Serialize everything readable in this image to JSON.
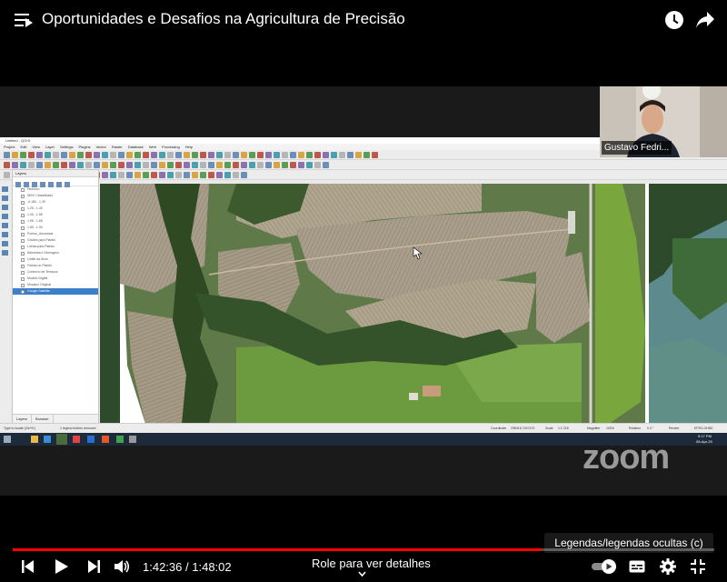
{
  "header": {
    "title": "Oportunidades e Desafios na Agricultura de Precisão",
    "icons": [
      "menu-icon",
      "watch-later-icon",
      "share-icon"
    ]
  },
  "qgis": {
    "title": "Untitled - QGIS",
    "menu": [
      "Project",
      "Edit",
      "View",
      "Layer",
      "Settings",
      "Plugins",
      "Vector",
      "Raster",
      "Database",
      "Web",
      "Processing",
      "Help"
    ],
    "panel_title": "Layers",
    "layers": [
      {
        "label": "Histórico",
        "selected": false
      },
      {
        "label": "NDVI Classificado",
        "selected": false
      },
      {
        "label": "-0.180 - 1.25",
        "selected": false
      },
      {
        "label": "1.25 - 1.40",
        "selected": false
      },
      {
        "label": "1.40 - 1.55",
        "selected": false
      },
      {
        "label": "1.55 - 1.65",
        "selected": false
      },
      {
        "label": "1.65 - 1.90",
        "selected": false
      },
      {
        "label": "Pontos_Amostrais",
        "selected": false
      },
      {
        "label": "Grades para Plantio",
        "selected": false
      },
      {
        "label": "Linhas para Plantio",
        "selected": false
      },
      {
        "label": "Altimetria e Drenagem",
        "selected": false
      },
      {
        "label": "Limite da Área",
        "selected": false
      },
      {
        "label": "Falhas no Plantio",
        "selected": false
      },
      {
        "label": "Contorno de Terraços",
        "selected": false
      },
      {
        "label": "Modelo Digital",
        "selected": false
      },
      {
        "label": "Mosaico Original",
        "selected": false
      },
      {
        "label": "Google Satellite",
        "selected": true
      }
    ],
    "panel_tabs": [
      "Layers",
      "Browser"
    ],
    "status": {
      "locate": "Type to locate (Ctrl+K)",
      "message": "1 legend entries removed",
      "coordinate_label": "Coordinate",
      "coordinate": "298416,7497473",
      "scale_label": "Scale",
      "scale": "1:2 218",
      "magnifier_label": "Magnifier",
      "magnifier": "100%",
      "rotation_label": "Rotation",
      "rotation": "0.0 °",
      "render_label": "Render",
      "epsg": "EPSG:31982"
    },
    "taskbar_clock": {
      "time": "9:17 PM",
      "date": "08-Apr-20"
    }
  },
  "webcam": {
    "name": "Gustavo Fedri..."
  },
  "watermark": "zoom",
  "tooltip": "Legendas/legendas ocultas (c)",
  "player": {
    "progress": 0.754,
    "current_time": "1:42:36",
    "separator": "/",
    "duration": "1:48:02",
    "scroll_hint": "Role para ver detalhes",
    "autoplay_on": true,
    "controls": [
      "previous-icon",
      "play-icon",
      "next-icon",
      "volume-icon",
      "autoplay-toggle",
      "captions-icon",
      "settings-icon",
      "exit-fullscreen-icon"
    ]
  },
  "colors": {
    "progress_fill": "#ff0000",
    "progress_track": "#4d4d4d",
    "background": "#000000",
    "selected_layer": "#3d7ec9"
  }
}
